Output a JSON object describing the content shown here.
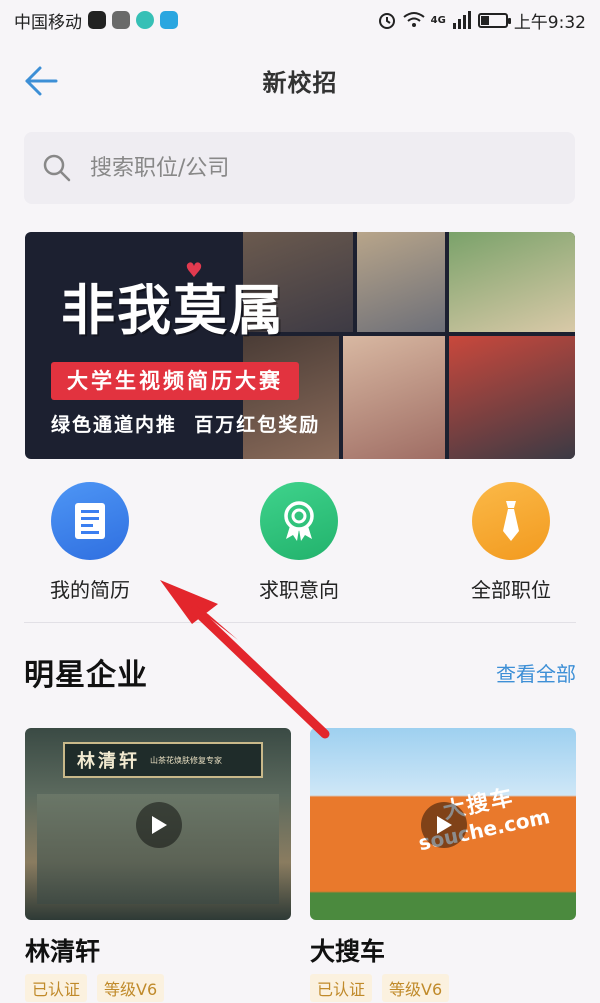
{
  "status_bar": {
    "carrier": "中国移动",
    "network": "4G",
    "time": "上午9:32",
    "battery_level": 0.35
  },
  "header": {
    "title": "新校招",
    "back_icon": "back-arrow-icon"
  },
  "search": {
    "placeholder": "搜索职位/公司",
    "value": ""
  },
  "banner": {
    "logo_text": "非我莫属",
    "tag": "大学生视频简历大赛",
    "subtitle": "绿色通道内推  百万红包奖励"
  },
  "shortcuts": [
    {
      "label": "我的简历",
      "icon": "resume-icon",
      "color": "#3c7ff0"
    },
    {
      "label": "求职意向",
      "icon": "award-ribbon-icon",
      "color": "#2cbf7a"
    },
    {
      "label": "全部职位",
      "icon": "necktie-icon",
      "color": "#f5a623"
    }
  ],
  "section": {
    "title": "明星企业",
    "view_all": "查看全部"
  },
  "companies": [
    {
      "name": "林清轩",
      "sign": "林清轩",
      "sign_sub": "山茶花焕肤修复专家",
      "tags": [
        "已认证",
        "等级V6"
      ]
    },
    {
      "name": "大搜车",
      "sign": "大搜车",
      "sign_sub": "souche.com",
      "tags": [
        "已认证",
        "等级V6"
      ]
    }
  ],
  "colors": {
    "accent_blue": "#3d8fd6",
    "banner_red": "#e2333f",
    "annotation_arrow": "#e3262c",
    "tag_text": "#c08a2a",
    "tag_bg": "#fbf1df"
  }
}
